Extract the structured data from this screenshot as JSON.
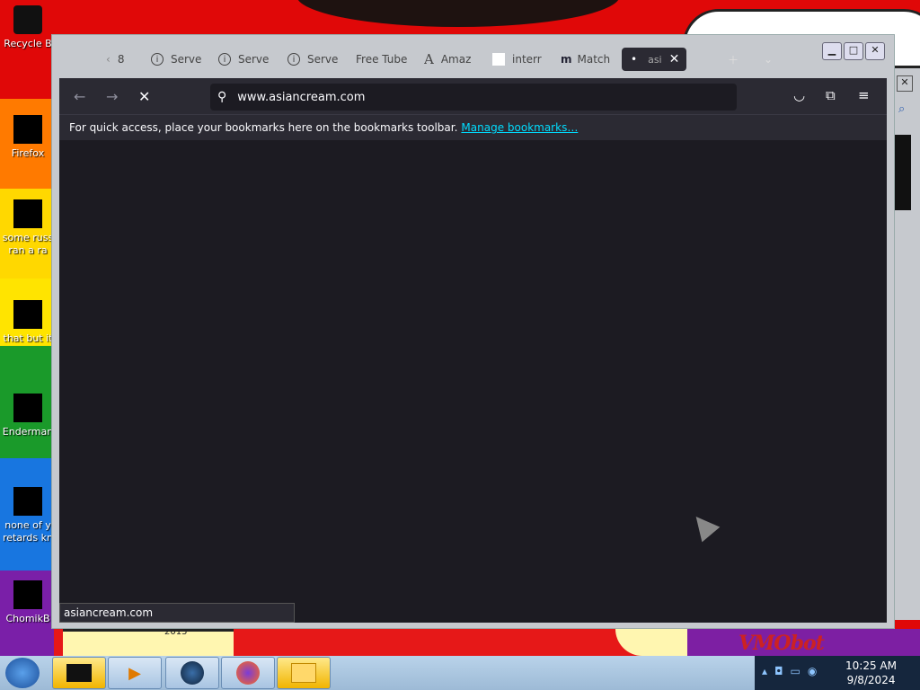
{
  "desktop": {
    "icons": [
      {
        "label": "Recycle B",
        "icon": "recycle-bin-icon"
      },
      {
        "label": "Firefox",
        "icon": "firefox-icon"
      },
      {
        "label": "some russ",
        "label2": "ran a ra",
        "icon": "file-icon"
      },
      {
        "label": "that but it",
        "icon": "folder-icon"
      },
      {
        "label": "Enderman",
        "icon": "app-icon"
      },
      {
        "label": "none of y",
        "label2": "retards kn",
        "icon": "opera-icon"
      },
      {
        "label": "ChomikB",
        "icon": "chomik-icon"
      }
    ],
    "wallpaper_text": "VMObot",
    "wallpaper_year": "2015"
  },
  "browser": {
    "tabs": [
      {
        "label": "8",
        "icon": "chevron-left-icon"
      },
      {
        "label": "Serve",
        "icon": "info-icon"
      },
      {
        "label": "Serve",
        "icon": "info-icon"
      },
      {
        "label": "Serve",
        "icon": "info-icon"
      },
      {
        "label": "Free Tube",
        "icon": ""
      },
      {
        "label": "Amaz",
        "icon": "amazon-icon"
      },
      {
        "label": "interr",
        "icon": "blank-page-icon"
      },
      {
        "label": "Match",
        "icon": "match-icon"
      },
      {
        "label": "asi",
        "icon": "loading-dot-icon",
        "active": true
      }
    ],
    "url": "www.asiancream.com",
    "bookmarks_message": "For quick access, place your bookmarks here on the bookmarks toolbar.",
    "bookmarks_link": "Manage bookmarks…",
    "status_text": "asiancream.com"
  },
  "taskbar": {
    "items": [
      "terminal",
      "media-player",
      "globe",
      "firefox",
      "file-explorer"
    ],
    "time": "10:25 AM",
    "date": "9/8/2024"
  }
}
